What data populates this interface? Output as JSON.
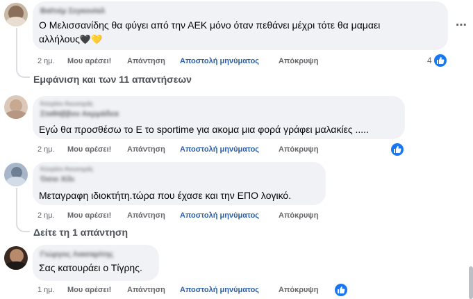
{
  "actions": {
    "like": "Μου αρέσει!",
    "reply": "Απάντηση",
    "message": "Αποστολή μηνύματος",
    "hide": "Απόκρυψη"
  },
  "comments": [
    {
      "author": "Βαϊτιέμ Σεγκουίαλ",
      "line1": "Ο Μελισσανίδης θα φύγει από την ΑΕΚ μόνο όταν πεθάνει μέχρι τότε θα μαμαει",
      "line2": "αλλήλους",
      "emoji": "🖤💛",
      "time": "2 ημ.",
      "reactions": "4",
      "more_icon": "ellipsis-icon",
      "replies_link": "Εμφάνιση και των 11 απαντήσεων"
    },
    {
      "author_sub": "Κουρίου Ανωνυμάς",
      "author": "Σταθάββου Ακρμάδεα",
      "text": "Εγώ θα προσθέσω το Ε το sportime για ακομα μια φορά γράφει μαλακίες .....",
      "time": "2 ημ."
    },
    {
      "author_sub": "Κουρίου Ανωνυμάς",
      "author": "Όσιο Χίλι",
      "text": "Μεταγραφη ιδιοκτήτη.τώρα που έχασε και την ΕΠΟ λογικό.",
      "time": "2 ημ.",
      "replies_link": "Δείτε τη 1 απάντηση"
    },
    {
      "author": "Γιώργος Λιασαρίτης",
      "text": "Σας κατουράει ο Τίγρης.",
      "time": "1 ημ."
    }
  ],
  "colors": {
    "accent": "#1877f2",
    "bubble": "#f0f2f5",
    "secondary_text": "#65676b"
  }
}
